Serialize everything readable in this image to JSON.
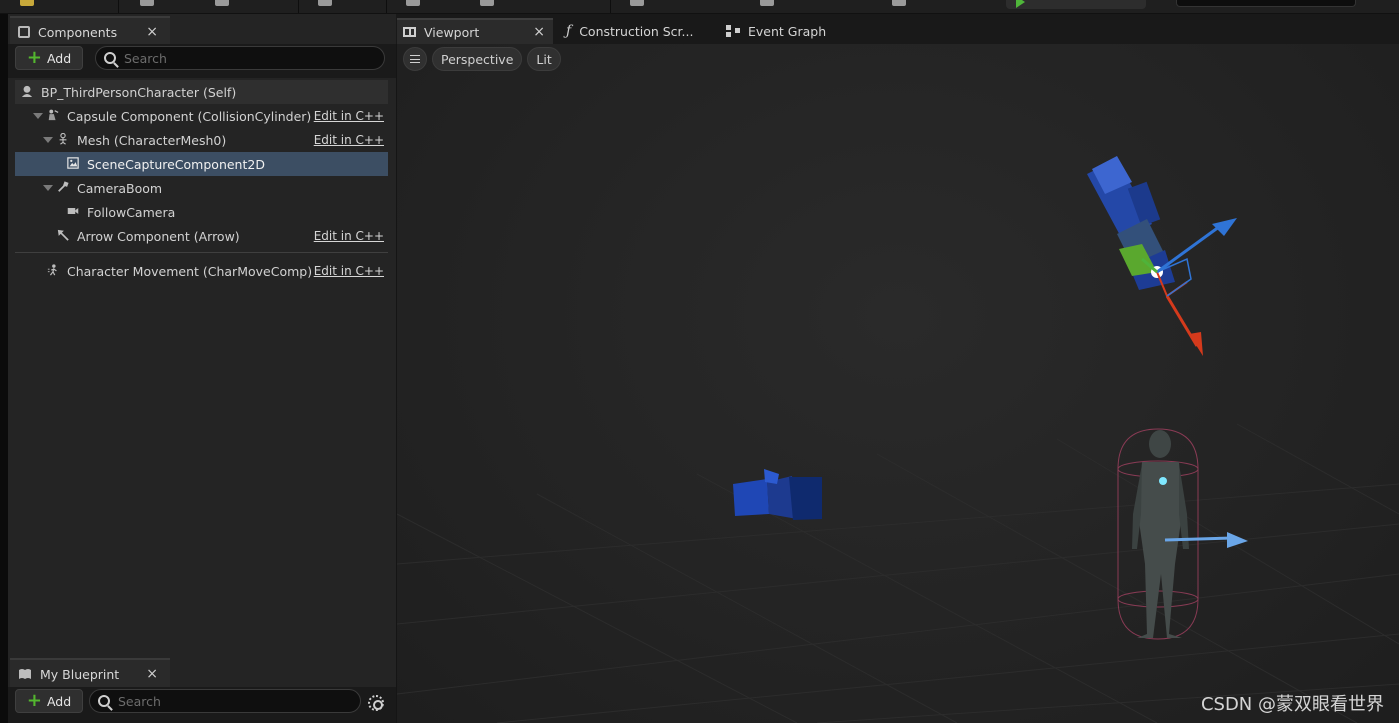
{
  "components_panel": {
    "tab_label": "Components",
    "tab_close": "×",
    "add_label": "Add",
    "search_placeholder": "Search",
    "tree": [
      {
        "label": "BP_ThirdPersonCharacter (Self)",
        "icon": "pawn-icon"
      },
      {
        "label": "Capsule Component (CollisionCylinder)",
        "icon": "capsule-icon",
        "edit": "Edit in C++"
      },
      {
        "label": "Mesh (CharacterMesh0)",
        "icon": "skeletal-mesh-icon",
        "edit": "Edit in C++"
      },
      {
        "label": "SceneCaptureComponent2D",
        "icon": "scene-capture-icon",
        "selected": true
      },
      {
        "label": "CameraBoom",
        "icon": "spring-arm-icon"
      },
      {
        "label": "FollowCamera",
        "icon": "camera-icon"
      },
      {
        "label": "Arrow Component (Arrow)",
        "icon": "arrow-icon",
        "edit": "Edit in C++"
      },
      {
        "label": "Character Movement (CharMoveComp)",
        "icon": "movement-icon",
        "edit": "Edit in C++"
      }
    ]
  },
  "blueprint_panel": {
    "tab_label": "My Blueprint",
    "tab_close": "×",
    "add_label": "Add",
    "search_placeholder": "Search"
  },
  "editor_tabs": {
    "viewport": "Viewport",
    "viewport_close": "×",
    "construction": "Construction Scr...",
    "event_graph": "Event Graph"
  },
  "viewport": {
    "projection": "Perspective",
    "view_mode": "Lit"
  },
  "watermark": "CSDN @蒙双眼看世界",
  "colors": {
    "selection": "#3c4e63",
    "add_plus": "#53b62f",
    "camera_blue": "#2448a8",
    "gizmo_x": "#d53a1c",
    "gizmo_y": "#4fb33a",
    "gizmo_z": "#2f74d6"
  }
}
